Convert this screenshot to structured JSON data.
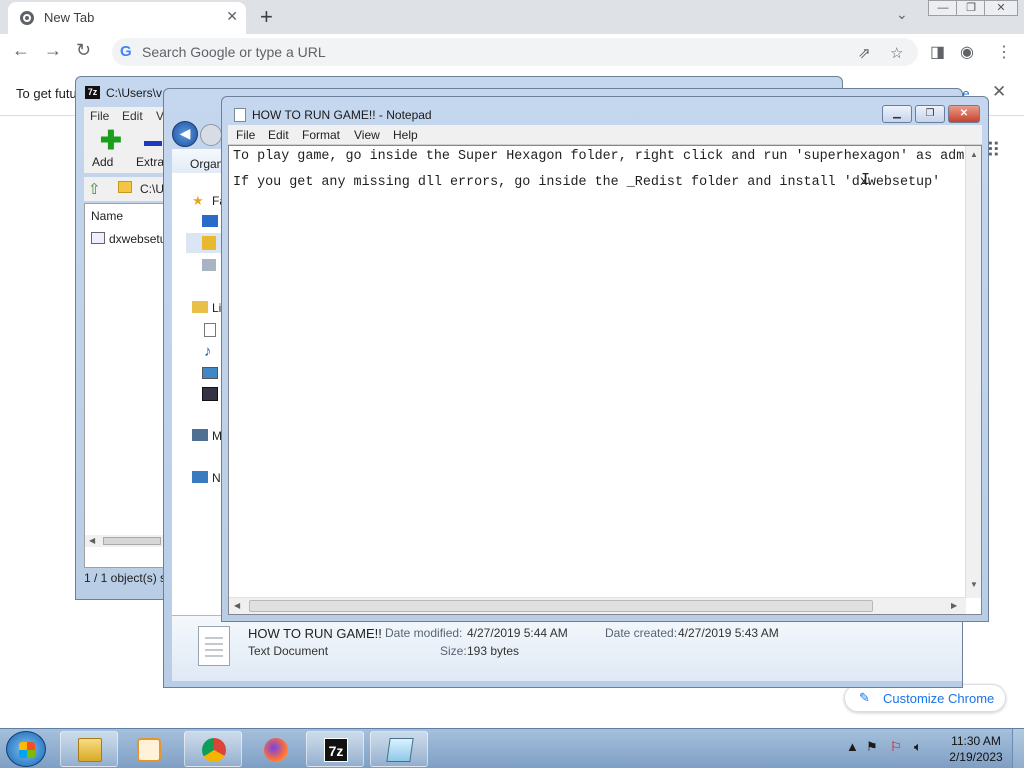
{
  "chrome": {
    "tab_title": "New Tab",
    "tab_close": "✕",
    "new_tab": "+",
    "omnibox_placeholder": "Search Google or type a URL",
    "infobar_text": "To get futu",
    "infobar_link": "re",
    "customize_label": "Customize Chrome",
    "window_buttons": [
      "—",
      "❐",
      "✕"
    ]
  },
  "sevenzip": {
    "title": "C:\\Users\\v",
    "menu": [
      "File",
      "Edit",
      "V"
    ],
    "add_label": "Add",
    "extract_label": "Extract",
    "address": "C:\\U",
    "column_name": "Name",
    "files": [
      {
        "name": "dxwebsetu"
      }
    ],
    "status": "1 / 1 object(s) s"
  },
  "explorer": {
    "organize": "Organ",
    "nav": [
      {
        "icon": "star-icon",
        "label": "Fa"
      },
      {
        "icon": "desktop-icon",
        "label": ""
      },
      {
        "icon": "downloads-icon",
        "label": ""
      },
      {
        "icon": "recent-places-icon",
        "label": ""
      },
      {
        "icon": "libraries-icon",
        "label": "Li"
      },
      {
        "icon": "documents-icon",
        "label": ""
      },
      {
        "icon": "music-icon",
        "label": ""
      },
      {
        "icon": "pictures-icon",
        "label": ""
      },
      {
        "icon": "videos-icon",
        "label": ""
      },
      {
        "icon": "computer-icon",
        "label": "M"
      },
      {
        "icon": "network-icon",
        "label": "N"
      }
    ],
    "details": {
      "file_name": "HOW TO RUN GAME!!",
      "file_type": "Text Document",
      "modified_label": "Date modified:",
      "modified_value": "4/27/2019 5:44 AM",
      "created_label": "Date created:",
      "created_value": "4/27/2019 5:43 AM",
      "size_label": "Size:",
      "size_value": "193 bytes"
    }
  },
  "notepad": {
    "title": "HOW TO RUN GAME!! - Notepad",
    "menu": [
      "File",
      "Edit",
      "Format",
      "View",
      "Help"
    ],
    "lines": [
      "To play game, go inside the Super Hexagon folder, right click and run 'superhexagon' as adm",
      "If you get any missing dll errors, go inside the _Redist folder and install 'dxwebsetup'"
    ]
  },
  "taskbar": {
    "apps": [
      "windows-explorer",
      "media-player",
      "chrome",
      "firefox",
      "7-zip",
      "notepad"
    ],
    "seven_zip_label": "7z",
    "clock_time": "11:30 AM",
    "clock_date": "2/19/2023"
  }
}
